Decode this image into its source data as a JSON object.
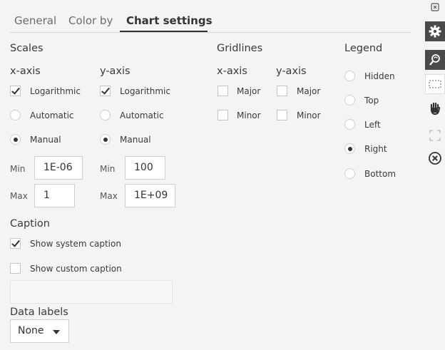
{
  "tabs": [
    {
      "label": "General"
    },
    {
      "label": "Color by"
    },
    {
      "label": "Chart settings"
    }
  ],
  "scales": {
    "heading": "Scales",
    "x_axis": {
      "label": "x-axis",
      "logarithmic_label": "Logarithmic",
      "logarithmic": true,
      "automatic_label": "Automatic",
      "manual_label": "Manual",
      "mode": "Manual",
      "min_label": "Min",
      "min_value": "1E-06",
      "max_label": "Max",
      "max_value": "1"
    },
    "y_axis": {
      "label": "y-axis",
      "logarithmic_label": "Logarithmic",
      "logarithmic": true,
      "automatic_label": "Automatic",
      "manual_label": "Manual",
      "mode": "Manual",
      "min_label": "Min",
      "min_value": "100",
      "max_label": "Max",
      "max_value": "1E+09"
    }
  },
  "gridlines": {
    "heading": "Gridlines",
    "x_axis": {
      "label": "x-axis",
      "major_label": "Major",
      "minor_label": "Minor",
      "major": false,
      "minor": false
    },
    "y_axis": {
      "label": "y-axis",
      "major_label": "Major",
      "minor_label": "Minor",
      "major": false,
      "minor": false
    }
  },
  "legend": {
    "heading": "Legend",
    "options": [
      "Hidden",
      "Top",
      "Left",
      "Right",
      "Bottom"
    ],
    "selected": "Right"
  },
  "caption": {
    "heading": "Caption",
    "show_system_label": "Show system caption",
    "show_system": true,
    "show_custom_label": "Show custom caption",
    "show_custom": false,
    "custom_text": ""
  },
  "data_labels": {
    "heading": "Data labels",
    "value": "None"
  },
  "toolbar": {
    "icons": [
      "collapse-icon",
      "settings-gear-icon",
      "lasso-zoom-icon",
      "rectangle-select-icon",
      "pan-hand-icon",
      "expand-icon",
      "close-icon"
    ]
  },
  "colors": {
    "background": "#f4f4f4",
    "toolbar_active": "#4a4a4a",
    "text": "#3a3a3a"
  }
}
